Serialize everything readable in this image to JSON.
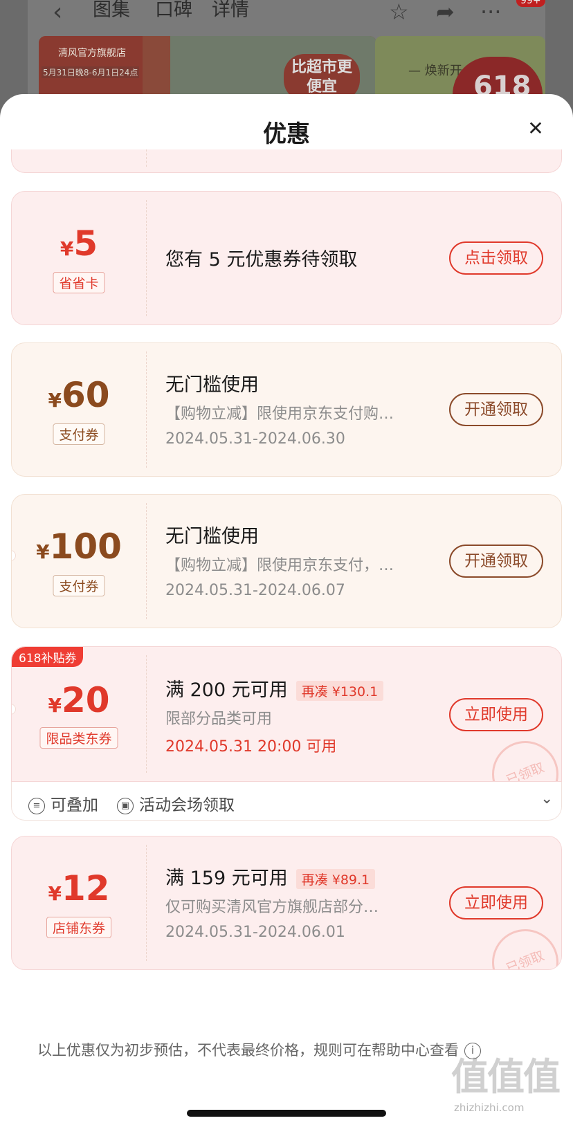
{
  "background": {
    "nav": {
      "tabs": [
        "图集",
        "口碑",
        "详情"
      ],
      "badge": "99+"
    },
    "banner": {
      "brand": "清风官方旗舰店",
      "date_range": "5月31日晚8-6月1日24点",
      "slogan": "比超市更便宜",
      "right_text": "— 焕新开",
      "promo": "618"
    }
  },
  "sheet": {
    "title": "优惠",
    "close_icon": "close-icon"
  },
  "coupons": [
    {
      "currency": "¥",
      "amount": "5",
      "tag": "省省卡",
      "title": "您有 5 元优惠券待领取",
      "button": "点击领取",
      "theme": "red"
    },
    {
      "currency": "¥",
      "amount": "60",
      "tag": "支付券",
      "title": "无门槛使用",
      "desc": "【购物立减】限使用京东支付购…",
      "date": "2024.05.31-2024.06.30",
      "button": "开通领取",
      "theme": "brown"
    },
    {
      "currency": "¥",
      "amount": "100",
      "tag": "支付券",
      "title": "无门槛使用",
      "desc": "【购物立减】限使用京东支付，…",
      "date": "2024.05.31-2024.06.07",
      "button": "开通领取",
      "theme": "brown"
    },
    {
      "corner_badge": "618补贴券",
      "currency": "¥",
      "amount": "20",
      "tag": "限品类东券",
      "title": "满 200 元可用",
      "pill": "再凑 ¥130.1",
      "desc": "限部分品类可用",
      "date": "2024.05.31 20:00 可用",
      "button": "立即使用",
      "stamp": "已领取",
      "theme": "red",
      "footer": {
        "stackable": "可叠加",
        "source": "活动会场领取"
      }
    },
    {
      "currency": "¥",
      "amount": "12",
      "tag": "店铺东券",
      "title": "满 159 元可用",
      "pill": "再凑 ¥89.1",
      "desc": "仅可购买清风官方旗舰店部分…",
      "date": "2024.05.31-2024.06.01",
      "button": "立即使用",
      "stamp": "已领取",
      "theme": "red"
    }
  ],
  "disclaimer": "以上优惠仅为初步预估，不代表最终价格，规则可在帮助中心查看",
  "watermark": {
    "logo": "值值值",
    "site": "zhizhizhi.com"
  }
}
